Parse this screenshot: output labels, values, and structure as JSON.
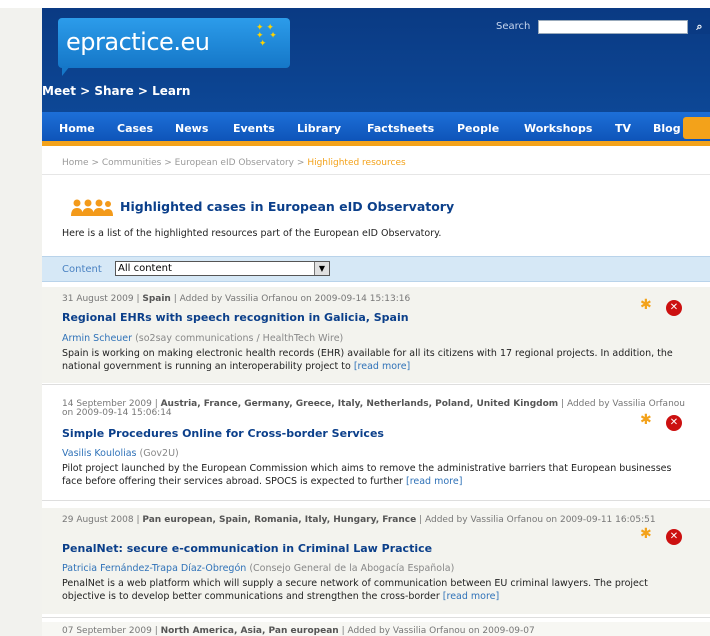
{
  "header": {
    "logo_main": "epractice",
    "logo_suffix": ".eu",
    "tagline": "Meet > Share > Learn",
    "search_label": "Search",
    "search_value": "",
    "search_button": "⌕"
  },
  "nav": {
    "items": [
      {
        "label": "Home"
      },
      {
        "label": "Cases"
      },
      {
        "label": "News"
      },
      {
        "label": "Events"
      },
      {
        "label": "Library"
      },
      {
        "label": "Factsheets"
      },
      {
        "label": "People"
      },
      {
        "label": "Workshops"
      },
      {
        "label": "TV"
      },
      {
        "label": "Blog"
      }
    ]
  },
  "breadcrumb": {
    "items": [
      "Home",
      "Communities",
      "European eID Observatory"
    ],
    "separator": ">",
    "current": "Highlighted resources"
  },
  "page": {
    "title": "Highlighted cases in European eID Observatory",
    "intro": "Here is a list of the highlighted resources part of the European eID Observatory."
  },
  "filter": {
    "label": "Content",
    "selected": "All content"
  },
  "items": [
    {
      "date": "31 August 2009",
      "countries": "Spain",
      "added": "| Added by Vassilia Orfanou on 2009-09-14 15:13:16",
      "title": "Regional EHRs with speech recognition in Galicia, Spain",
      "author": "Armin Scheuer",
      "org": "(so2say communications / HealthTech Wire)",
      "desc": "Spain is working on making electronic health records (EHR) available for all its citizens with 17 regional projects. In addition, the national government is running an interoperability project to",
      "more": "[read more]"
    },
    {
      "date": "14 September 2009",
      "countries": "Austria, France, Germany, Greece, Italy, Netherlands, Poland, United Kingdom",
      "added": "| Added by Vassilia Orfanou on 2009-09-14 15:06:14",
      "title": "Simple Procedures Online for Cross-border Services",
      "author": "Vasilis Koulolias",
      "org": "(Gov2U)",
      "desc": "Pilot project launched by the European Commission which aims to remove the administrative barriers that European businesses face before offering their services abroad. SPOCS is expected to further",
      "more": "[read more]"
    },
    {
      "date": "29 August 2008",
      "countries": "Pan european, Spain, Romania, Italy, Hungary, France",
      "added": "| Added by Vassilia Orfanou on 2009-09-11 16:05:51",
      "title": "PenalNet: secure e-communication in Criminal Law Practice",
      "author": "Patricia Fernández-Trapa Díaz-Obregón",
      "org": "(Consejo General de la Abogacía Española)",
      "desc": "PenalNet is a web platform which will supply a secure network of communication between EU criminal lawyers. The project objective is to develop better communications and strengthen the cross-border",
      "more": "[read more]"
    },
    {
      "date": "07 September 2009",
      "countries": "North America, Asia, Pan european",
      "added": "| Added by Vassilia Orfanou on 2009-09-07"
    }
  ],
  "actions": {
    "star_glyph": "✱",
    "delete_glyph": "✕"
  },
  "colors": {
    "header_blue": "#0b3f8a",
    "nav_blue": "#1560c9",
    "accent_orange": "#f3a21a",
    "link_blue": "#2f72b8",
    "delete_red": "#cc1010"
  }
}
